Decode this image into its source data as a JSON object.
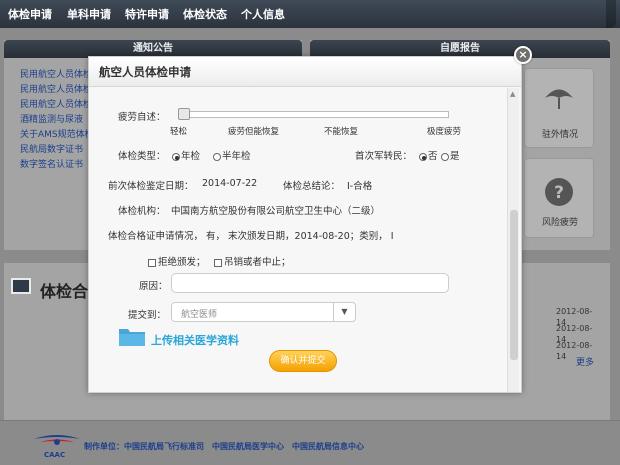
{
  "nav": {
    "items": [
      "体检申请",
      "单科申请",
      "特许申请",
      "体检状态",
      "个人信息"
    ]
  },
  "background": {
    "notice_header": "通知公告",
    "report_header": "自愿报告",
    "notices": [
      "民用航空人员体检",
      "民用航空人员体检",
      "民用航空人员体检",
      "酒精监测与尿液",
      "关于AMS规范体检",
      "民航局数字证书",
      "数字签名认证书"
    ],
    "side_cards": [
      "驻外情况",
      "风险疲劳"
    ],
    "check_title": "体检合",
    "dates": [
      "2012-08-14",
      "2012-08-14",
      "2012-08-14",
      "2012-08-14"
    ],
    "more": "更多"
  },
  "footer": {
    "maker": "制作单位：中国民航局飞行标准司　中国民航局医学中心　中国民航局信息中心",
    "logo_text": "CAAC"
  },
  "modal": {
    "title": "航空人员体检申请",
    "fatigue_label": "疲劳自述：",
    "fatigue_level": 0,
    "fatigue_ticks": [
      "轻松",
      "疲劳但能恢复",
      "不能恢复",
      "极度疲劳"
    ],
    "check_type_label": "体检类型：",
    "check_type_options": [
      "年检",
      "半年检"
    ],
    "check_type_selected": "年检",
    "military_label": "首次军转民：",
    "military_options": [
      "否",
      "是"
    ],
    "military_selected": "否",
    "prev_date_label": "前次体检鉴定日期：",
    "prev_date": "2014-07-22",
    "conclusion_label": "体检总结论：",
    "conclusion": "Ⅰ-合格",
    "org_label": "体检机构：",
    "org": "中国南方航空股份有限公司航空卫生中心（二级）",
    "cert_line": "体检合格证申请情况，  有，  末次颁发日期，2014-08-20；类别，  Ⅰ",
    "refuse_option": "拒绝颁发；",
    "revoke_option": "吊销或者中止；",
    "reason_label": "原因：",
    "reason_value": "",
    "submit_to_label": "提交到：",
    "submit_to_value": "航空医师",
    "upload_label": "上传相关医学资料",
    "confirm_button": "确认并提交"
  }
}
